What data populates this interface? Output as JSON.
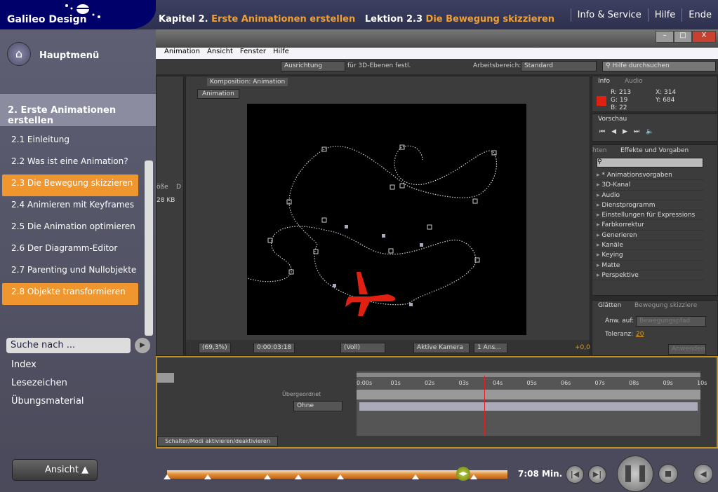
{
  "brand": "Galileo Design",
  "header": {
    "chapter_label": "Kapitel 2.",
    "chapter_title": "Erste Animationen erstellen",
    "lesson_label": "Lektion 2.3",
    "lesson_title": "Die Bewegung skizzieren",
    "links": [
      "Info & Service",
      "Hilfe",
      "Ende"
    ]
  },
  "sidebar": {
    "home": "Hauptmenü",
    "chapter": "2. Erste Animationen erstellen",
    "lessons": [
      {
        "label": "2.1 Einleitung"
      },
      {
        "label": "2.2 Was ist eine Animation?"
      },
      {
        "label": "2.3 Die Bewegung skizzieren",
        "active": true
      },
      {
        "label": "2.4 Animieren mit Keyframes"
      },
      {
        "label": "2.5 Die Animation optimieren"
      },
      {
        "label": "2.6 Der Diagramm-Editor"
      },
      {
        "label": "2.7 Parenting und Nullobjekte"
      },
      {
        "label": "2.8 Objekte transformieren",
        "active": true
      }
    ],
    "search_placeholder": "Suche nach ...",
    "links": [
      "Index",
      "Lesezeichen",
      "Übungsmaterial"
    ]
  },
  "ae": {
    "menu": [
      "Animation",
      "Ansicht",
      "Fenster",
      "Hilfe"
    ],
    "toolbar": {
      "align": "Ausrichtung",
      "align_suffix": "für 3D-Ebenen festl.",
      "workspace_label": "Arbeitsbereich:",
      "workspace": "Standard",
      "help_search": "Hilfe durchsuchen"
    },
    "comp": {
      "tab": "Komposition: Animation",
      "subtab": "Animation",
      "zoom": "(69,3%)",
      "timecode": "0:00:03:18",
      "resolution": "(Voll)",
      "camera": "Aktive Kamera",
      "views": "1 Ans...",
      "exposure": "+0,0"
    },
    "project": {
      "size": "28 KB",
      "col1": "öße",
      "col2": "D"
    },
    "info": {
      "tabs": [
        "Info",
        "Audio"
      ],
      "r": "R: 213",
      "g": "G: 19",
      "b": "B: 22",
      "x": "X: 314",
      "y": "Y: 684",
      "color": "#e02010"
    },
    "preview": {
      "tab": "Vorschau"
    },
    "effects": {
      "tab_prev": "hten",
      "tab": "Effekte und Vorgaben",
      "items": [
        "* Animationsvorgaben",
        "3D-Kanal",
        "Audio",
        "Dienstprogramm",
        "Einstellungen für Expressions",
        "Farbkorrektur",
        "Generieren",
        "Kanäle",
        "Keying",
        "Matte",
        "Perspektive"
      ]
    },
    "smooth": {
      "tabs": [
        "Glätten",
        "Bewegung skizziere"
      ],
      "apply_label": "Anw. auf:",
      "apply_value": "Bewegungspfad",
      "tol_label": "Toleranz:",
      "tol_value": "20",
      "apply_button": "Anwenden"
    },
    "timeline": {
      "ticks": [
        "0:00s",
        "01s",
        "02s",
        "03s",
        "04s",
        "05s",
        "06s",
        "07s",
        "08s",
        "09s",
        "10s"
      ],
      "parent_header": "Übergeordnet",
      "parent_value": "Ohne",
      "switch_button": "Schalter/Modi aktivieren/deaktivieren",
      "current_time_s": 3.75
    }
  },
  "player": {
    "view_button": "Ansicht",
    "duration": "7:08 Min.",
    "progress": 0.87,
    "markers": [
      0,
      0.12,
      0.295,
      0.385,
      0.51,
      0.73,
      0.9
    ],
    "accent": "#f0962e"
  }
}
